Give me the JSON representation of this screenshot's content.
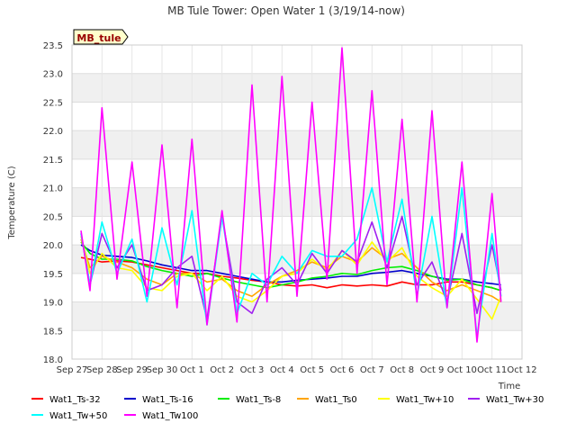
{
  "chart_data": {
    "type": "line",
    "title": "MB Tule Tower: Open Water 1 (3/19/14-now)",
    "xlabel": "Time",
    "ylabel": "Temperature (C)",
    "station_label": "MB_tule",
    "ylim": [
      18.0,
      23.5
    ],
    "xlim": [
      0,
      15
    ],
    "x_ticks": [
      {
        "x": 0,
        "label": "Sep 27"
      },
      {
        "x": 1,
        "label": "Sep 28"
      },
      {
        "x": 2,
        "label": "Sep 29"
      },
      {
        "x": 3,
        "label": "Sep 30"
      },
      {
        "x": 4,
        "label": "Oct 1"
      },
      {
        "x": 5,
        "label": "Oct 2"
      },
      {
        "x": 6,
        "label": "Oct 3"
      },
      {
        "x": 7,
        "label": "Oct 4"
      },
      {
        "x": 8,
        "label": "Oct 5"
      },
      {
        "x": 9,
        "label": "Oct 6"
      },
      {
        "x": 10,
        "label": "Oct 7"
      },
      {
        "x": 11,
        "label": "Oct 8"
      },
      {
        "x": 12,
        "label": "Oct 9"
      },
      {
        "x": 13,
        "label": "Oct 10"
      },
      {
        "x": 14,
        "label": "Oct 11"
      },
      {
        "x": 15,
        "label": "Oct 12"
      }
    ],
    "y_ticks": [
      {
        "y": 18.0,
        "label": "18.0"
      },
      {
        "y": 18.5,
        "label": "18.5"
      },
      {
        "y": 19.0,
        "label": "19.0"
      },
      {
        "y": 19.5,
        "label": "19.5"
      },
      {
        "y": 20.0,
        "label": "20.0"
      },
      {
        "y": 20.5,
        "label": "20.5"
      },
      {
        "y": 21.0,
        "label": "21.0"
      },
      {
        "y": 21.5,
        "label": "21.5"
      },
      {
        "y": 22.0,
        "label": "22.0"
      },
      {
        "y": 22.5,
        "label": "22.5"
      },
      {
        "y": 23.0,
        "label": "23.0"
      },
      {
        "y": 23.5,
        "label": "23.5"
      }
    ],
    "grid": true,
    "legend_position": "bottom",
    "x": [
      0.3,
      0.6,
      1.0,
      1.5,
      2.0,
      2.5,
      3.0,
      3.5,
      4.0,
      4.5,
      5.0,
      5.5,
      6.0,
      6.5,
      7.0,
      7.5,
      8.0,
      8.5,
      9.0,
      9.5,
      10.0,
      10.5,
      11.0,
      11.5,
      12.0,
      12.5,
      13.0,
      13.5,
      14.0,
      14.3
    ],
    "series": [
      {
        "name": "Wat1_Ts-32",
        "color": "#ff0000",
        "values": [
          19.78,
          19.75,
          19.7,
          19.72,
          19.7,
          19.65,
          19.6,
          19.55,
          19.5,
          19.5,
          19.45,
          19.42,
          19.38,
          19.35,
          19.3,
          19.28,
          19.3,
          19.25,
          19.3,
          19.28,
          19.3,
          19.28,
          19.35,
          19.3,
          19.3,
          19.35,
          19.35,
          19.3,
          19.25,
          19.2
        ]
      },
      {
        "name": "Wat1_Ts-16",
        "color": "#0000cc",
        "values": [
          20.0,
          19.9,
          19.82,
          19.8,
          19.78,
          19.72,
          19.65,
          19.6,
          19.55,
          19.55,
          19.5,
          19.45,
          19.4,
          19.35,
          19.35,
          19.38,
          19.4,
          19.42,
          19.45,
          19.45,
          19.5,
          19.52,
          19.55,
          19.5,
          19.45,
          19.4,
          19.4,
          19.35,
          19.32,
          19.3
        ]
      },
      {
        "name": "Wat1_Ts-8",
        "color": "#00ee00",
        "values": [
          20.05,
          19.85,
          19.75,
          19.75,
          19.72,
          19.62,
          19.55,
          19.5,
          19.45,
          19.5,
          19.42,
          19.35,
          19.3,
          19.25,
          19.3,
          19.35,
          19.42,
          19.45,
          19.5,
          19.48,
          19.55,
          19.6,
          19.62,
          19.55,
          19.45,
          19.38,
          19.4,
          19.3,
          19.25,
          19.2
        ]
      },
      {
        "name": "Wat1_Ts0",
        "color": "#ffa500",
        "values": [
          20.1,
          19.6,
          19.8,
          19.7,
          19.6,
          19.4,
          19.3,
          19.5,
          19.5,
          19.35,
          19.4,
          19.2,
          19.1,
          19.3,
          19.45,
          19.55,
          19.7,
          19.6,
          19.8,
          19.7,
          19.95,
          19.75,
          19.85,
          19.6,
          19.35,
          19.2,
          19.3,
          19.2,
          19.1,
          19.0
        ]
      },
      {
        "name": "Wat1_Tw+10",
        "color": "#ffff00",
        "values": [
          20.15,
          19.5,
          19.85,
          19.6,
          19.55,
          19.25,
          19.2,
          19.45,
          19.5,
          19.2,
          19.45,
          19.1,
          19.0,
          19.2,
          19.45,
          19.5,
          19.75,
          19.55,
          19.9,
          19.65,
          20.05,
          19.7,
          19.95,
          19.45,
          19.25,
          19.1,
          19.4,
          19.05,
          18.7,
          19.1
        ]
      },
      {
        "name": "Wat1_Tw+30",
        "color": "#a020f0",
        "values": [
          20.2,
          19.3,
          20.2,
          19.6,
          20.0,
          19.2,
          19.3,
          19.6,
          19.8,
          18.7,
          20.5,
          19.0,
          18.8,
          19.4,
          19.6,
          19.3,
          19.85,
          19.5,
          19.9,
          19.7,
          20.4,
          19.6,
          20.5,
          19.3,
          19.7,
          19.0,
          20.2,
          18.8,
          20.0,
          19.2
        ]
      },
      {
        "name": "Wat1_Tw+50",
        "color": "#00ffff",
        "values": [
          20.2,
          19.3,
          20.4,
          19.5,
          20.1,
          19.0,
          20.3,
          19.3,
          20.6,
          18.6,
          20.5,
          18.8,
          19.5,
          19.3,
          19.8,
          19.5,
          19.9,
          19.8,
          19.8,
          20.1,
          21.0,
          19.7,
          20.8,
          19.1,
          20.5,
          18.9,
          21.0,
          18.4,
          20.2,
          19.1
        ]
      },
      {
        "name": "Wat1_Tw100",
        "color": "#ff00ff",
        "values": [
          20.25,
          19.2,
          22.4,
          19.4,
          21.45,
          19.1,
          21.75,
          18.9,
          21.85,
          18.6,
          20.6,
          18.65,
          22.8,
          19.0,
          22.95,
          19.1,
          22.5,
          19.4,
          23.45,
          19.5,
          22.7,
          19.3,
          22.2,
          19.0,
          22.35,
          18.9,
          21.45,
          18.3,
          20.9,
          19.0
        ]
      }
    ]
  }
}
